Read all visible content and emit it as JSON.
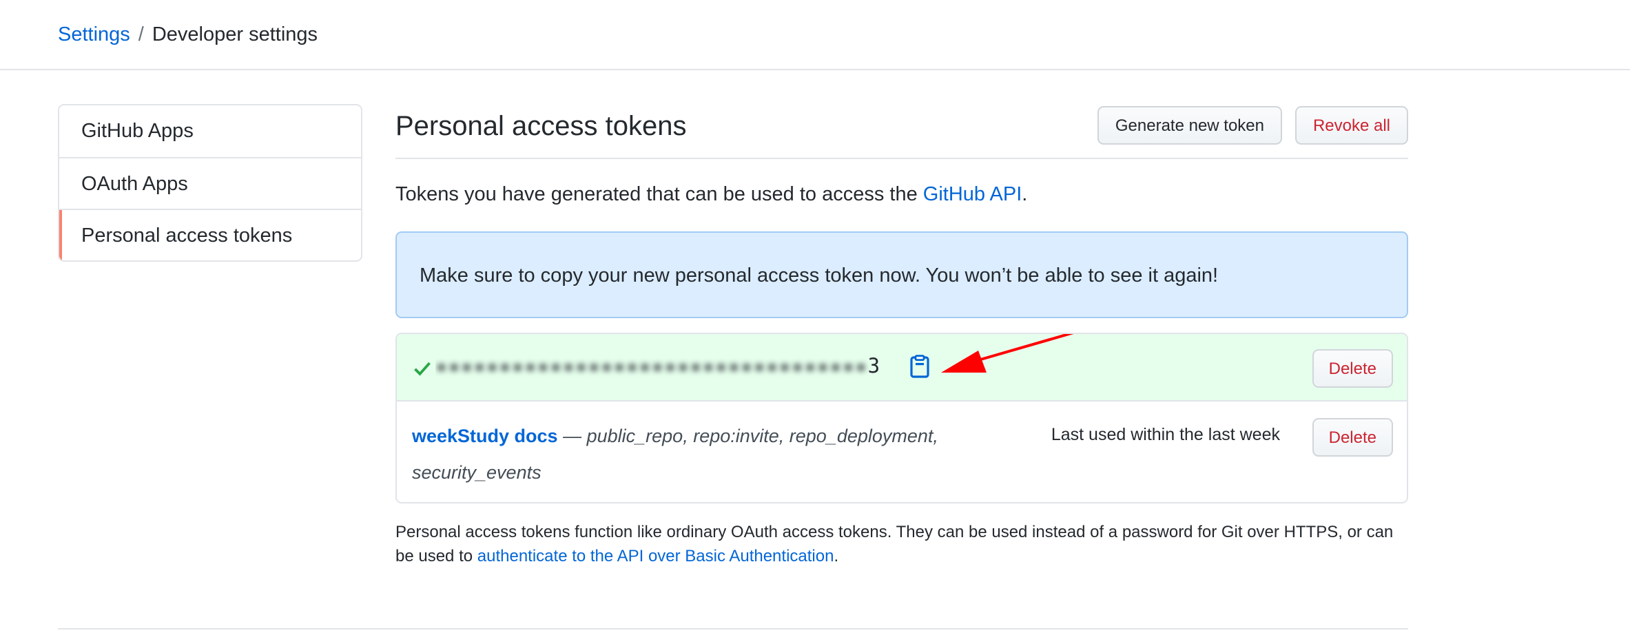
{
  "breadcrumb": {
    "root": "Settings",
    "separator": "/",
    "current": "Developer settings"
  },
  "sidebar": {
    "items": [
      {
        "label": "GitHub Apps",
        "selected": false
      },
      {
        "label": "OAuth Apps",
        "selected": false
      },
      {
        "label": "Personal access tokens",
        "selected": true
      }
    ]
  },
  "main": {
    "title": "Personal access tokens",
    "generate_button": "Generate new token",
    "revoke_button": "Revoke all",
    "intro_prefix": "Tokens you have generated that can be used to access the ",
    "intro_link": "GitHub API",
    "intro_suffix": ".",
    "flash_message": "Make sure to copy your new personal access token now. You won’t be able to see it again!",
    "new_token": {
      "value_blurred": "▪▪▪▪▪▪▪▪▪▪▪▪▪▪▪▪▪▪▪▪▪▪▪▪▪▪▪▪▪▪▪▪▪▪",
      "value_visible_tail": "3",
      "delete_label": "Delete"
    },
    "tokens": [
      {
        "name": "weekStudy docs",
        "dash": " — ",
        "scopes": "public_repo, repo:invite, repo_deployment, security_events",
        "last_used": "Last used within the last week",
        "delete_label": "Delete"
      }
    ],
    "note_prefix": "Personal access tokens function like ordinary OAuth access tokens. They can be used instead of a password for Git over HTTPS, or can be used to ",
    "note_link": "authenticate to the API over Basic Authentication",
    "note_suffix": "."
  },
  "colors": {
    "link": "#0366d6",
    "danger": "#cb2431",
    "flash_bg": "#dbedff",
    "success_bg": "#e6ffed",
    "selected_marker": "#f9826c",
    "check": "#28a745",
    "annotation_arrow": "#ff0000"
  },
  "icons": {
    "check": "check-icon",
    "clipboard": "clipboard-icon",
    "annotation": "red-arrow-annotation"
  }
}
